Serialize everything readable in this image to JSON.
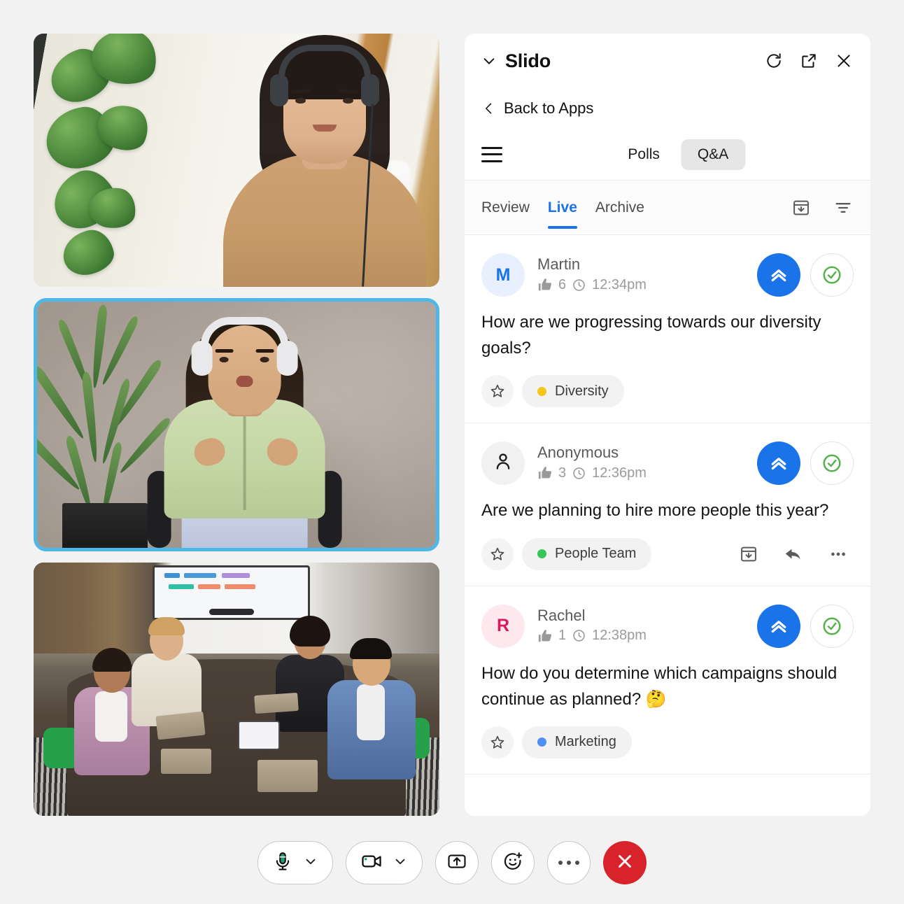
{
  "panel": {
    "title": "Slido",
    "collapse_icon": "chevron-down-icon",
    "header_actions": [
      {
        "name": "refresh-icon",
        "label": "Refresh"
      },
      {
        "name": "popout-icon",
        "label": "Open in new window"
      },
      {
        "name": "close-icon",
        "label": "Close"
      }
    ],
    "back_label": "Back to Apps",
    "back_icon": "chevron-left-icon",
    "menu_icon": "hamburger-menu-icon",
    "segments": [
      {
        "label": "Polls",
        "selected": false
      },
      {
        "label": "Q&A",
        "selected": true
      }
    ],
    "tabs": [
      {
        "label": "Review",
        "active": false
      },
      {
        "label": "Live",
        "active": true
      },
      {
        "label": "Archive",
        "active": false
      }
    ],
    "tab_actions": [
      {
        "name": "archive-icon",
        "label": "Archive all"
      },
      {
        "name": "filter-icon",
        "label": "Filter"
      }
    ],
    "accent_color": "#1a73e8"
  },
  "questions": [
    {
      "author": "Martin",
      "avatar_letter": "M",
      "avatar_style": "blue",
      "avatar_icon": "",
      "likes": "6",
      "time": "12:34pm",
      "text": "How are we progressing towards our diversity goals?",
      "tag": {
        "label": "Diversity",
        "color": "#f5c518"
      },
      "upvote_icon": "double-chevron-up-icon",
      "check_icon": "check-circle-icon",
      "star_icon": "star-outline-icon",
      "hover_actions": false
    },
    {
      "author": "Anonymous",
      "avatar_letter": "",
      "avatar_style": "gray",
      "avatar_icon": "person-icon",
      "likes": "3",
      "time": "12:36pm",
      "text": "Are we planning to hire more people this year?",
      "tag": {
        "label": "People Team",
        "color": "#34c759"
      },
      "upvote_icon": "double-chevron-up-icon",
      "check_icon": "check-circle-icon",
      "star_icon": "star-outline-icon",
      "hover_actions": true,
      "hover_action_names": [
        "archive-icon",
        "reply-icon",
        "more-icon"
      ]
    },
    {
      "author": "Rachel",
      "avatar_letter": "R",
      "avatar_style": "pink",
      "avatar_icon": "",
      "likes": "1",
      "time": "12:38pm",
      "text": "How do you determine which campaigns should continue as planned? 🤔",
      "tag": {
        "label": "Marketing",
        "color": "#4e8ef7"
      },
      "upvote_icon": "double-chevron-up-icon",
      "check_icon": "check-circle-icon",
      "star_icon": "star-outline-icon",
      "hover_actions": false
    }
  ],
  "video": {
    "tiles": [
      {
        "name": "participant-tile-1",
        "active_speaker": false,
        "description": "Woman with headset at desk, plant at left"
      },
      {
        "name": "participant-tile-2",
        "active_speaker": true,
        "description": "Woman in green shirt with headphones speaking"
      },
      {
        "name": "participant-tile-3",
        "active_speaker": false,
        "description": "Four people around a conference table"
      }
    ],
    "active_speaker_color": "#4db7e8"
  },
  "call_controls": [
    {
      "name": "microphone-button",
      "icon": "microphone-icon",
      "has_chevron": true,
      "state_color": "#1f9d76"
    },
    {
      "name": "camera-button",
      "icon": "camera-icon",
      "has_chevron": true,
      "state_color": "#1f9d76"
    },
    {
      "name": "share-screen-button",
      "icon": "share-screen-icon",
      "has_chevron": false
    },
    {
      "name": "reactions-button",
      "icon": "emoji-reaction-icon",
      "has_chevron": false
    },
    {
      "name": "more-options-button",
      "icon": "more-icon",
      "has_chevron": false
    },
    {
      "name": "end-call-button",
      "icon": "close-icon",
      "has_chevron": false,
      "color": "#d8232a"
    }
  ]
}
